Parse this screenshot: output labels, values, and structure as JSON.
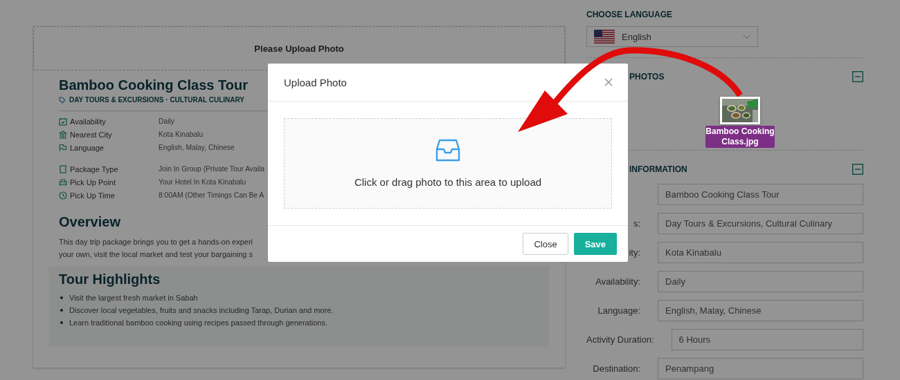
{
  "card": {
    "upload_prompt": "Please Upload Photo",
    "title": "Bamboo Cooking Class Tour",
    "categories": "DAY TOURS & EXCURSIONS · CULTURAL CULINARY",
    "detail_groups": [
      [
        {
          "kind": "calendar",
          "label": "Availability",
          "value": "Daily"
        },
        {
          "kind": "building",
          "label": "Nearest City",
          "value": "Kota Kinabalu"
        },
        {
          "kind": "flag",
          "label": "Language",
          "value": "English, Malay, Chinese"
        }
      ],
      [
        {
          "kind": "door",
          "label": "Package Type",
          "value": "Join In Group (Private Tour Availa"
        },
        {
          "kind": "car",
          "label": "Pick Up Point",
          "value": "Your Hotel In Kota Kinabalu"
        },
        {
          "kind": "clock",
          "label": "Pick Up Time",
          "value": "8:00AM (Other Timings Can Be A"
        }
      ]
    ],
    "overview": {
      "heading": "Overview",
      "lines": [
        "This day trip package brings you to get a hands-on experi",
        "your own, visit the local market and test your bargaining s"
      ]
    },
    "highlights": {
      "heading": "Tour Highlights",
      "items": [
        "Visit the largest fresh market in Sabah",
        "Discover local vegetables, fruits and snacks including Tarap, Durian and more.",
        "Learn traditional bamboo cooking using recipes passed through generations."
      ]
    }
  },
  "sidebar": {
    "language_heading": "CHOOSE LANGUAGE",
    "language": "English",
    "sections": [
      {
        "title": "PHOTOS",
        "expanded": true
      },
      {
        "title": "INFORMATION",
        "expanded": true
      }
    ],
    "fields": [
      {
        "value": "Bamboo Cooking Class Tour"
      },
      {
        "label": "s:",
        "value": "Day Tours & Excursions, Cultural Culinary"
      },
      {
        "label": "ity:",
        "value": "Kota Kinabalu"
      },
      {
        "label": "Availability:",
        "value": "Daily"
      },
      {
        "label": "Language:",
        "value": "English, Malay, Chinese"
      },
      {
        "label": "Activity Duration:",
        "value": "6 Hours"
      },
      {
        "label": "Destination:",
        "value": "Penampang"
      }
    ]
  },
  "modal": {
    "title": "Upload Photo",
    "dropzone_text": "Click or drag photo to this area to upload",
    "buttons": [
      {
        "kind": "secondary",
        "label": "Close"
      },
      {
        "kind": "primary",
        "label": "Save"
      }
    ]
  },
  "drag_file": {
    "name": "Bamboo Cooking Class.jpg"
  }
}
